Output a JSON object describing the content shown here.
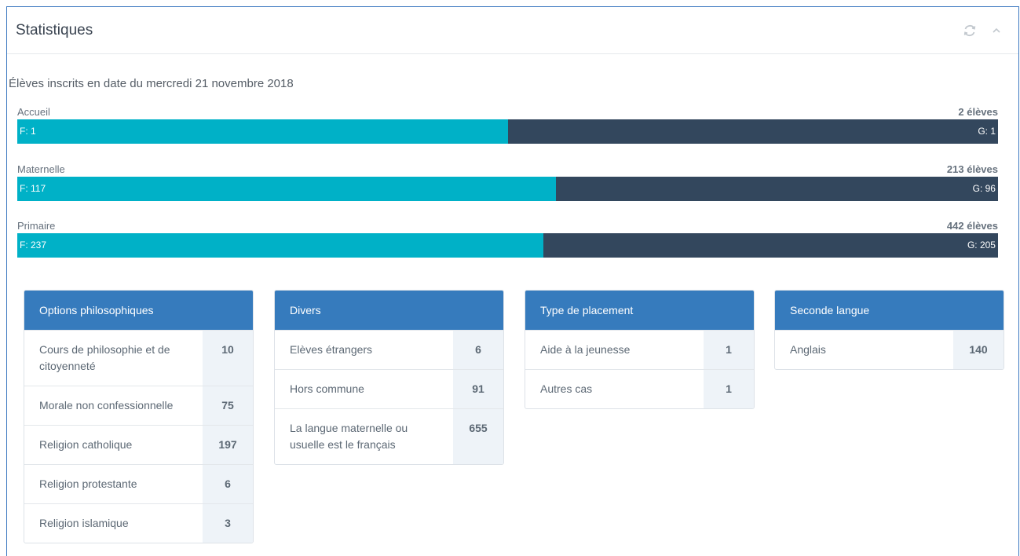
{
  "header": {
    "title": "Statistiques",
    "refresh_icon": "refresh-icon",
    "collapse_icon": "chevron-up-icon"
  },
  "date_line": "Élèves inscrits en date du mercredi 21 novembre 2018",
  "colors": {
    "girls": "#00b1c7",
    "boys": "#33475d",
    "card_header": "#367bbd"
  },
  "levels": [
    {
      "label": "Accueil",
      "total": "2 élèves",
      "f_label": "F: 1",
      "g_label": "G: 1",
      "f": 1,
      "g": 1
    },
    {
      "label": "Maternelle",
      "total": "213 élèves",
      "f_label": "F: 117",
      "g_label": "G: 96",
      "f": 117,
      "g": 96
    },
    {
      "label": "Primaire",
      "total": "442 élèves",
      "f_label": "F: 237",
      "g_label": "G: 205",
      "f": 237,
      "g": 205
    }
  ],
  "cards": [
    {
      "title": "Options philosophiques",
      "rows": [
        {
          "label": "Cours de philosophie et de citoyenneté",
          "count": "10"
        },
        {
          "label": "Morale non confessionnelle",
          "count": "75"
        },
        {
          "label": "Religion catholique",
          "count": "197"
        },
        {
          "label": "Religion protestante",
          "count": "6"
        },
        {
          "label": "Religion islamique",
          "count": "3"
        }
      ]
    },
    {
      "title": "Divers",
      "rows": [
        {
          "label": "Elèves étrangers",
          "count": "6"
        },
        {
          "label": "Hors commune",
          "count": "91"
        },
        {
          "label": "La langue maternelle ou usuelle est le français",
          "count": "655"
        }
      ]
    },
    {
      "title": "Type de placement",
      "rows": [
        {
          "label": "Aide à la jeunesse",
          "count": "1"
        },
        {
          "label": "Autres cas",
          "count": "1"
        }
      ]
    },
    {
      "title": "Seconde langue",
      "rows": [
        {
          "label": "Anglais",
          "count": "140"
        }
      ]
    }
  ]
}
